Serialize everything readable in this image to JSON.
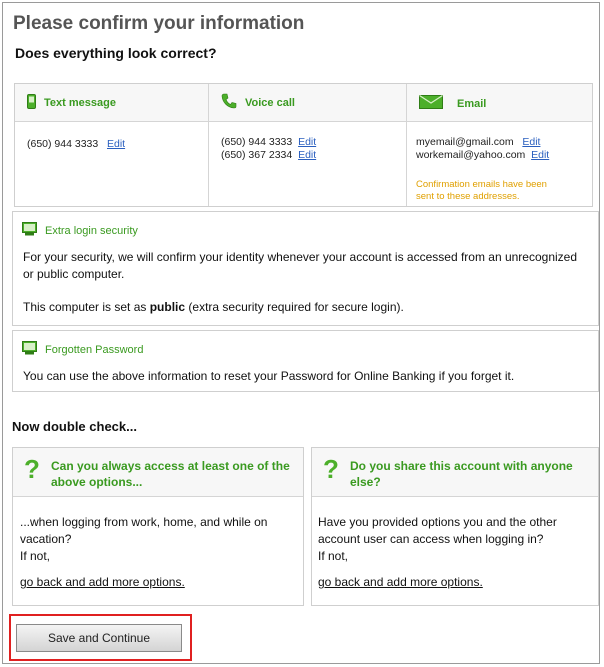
{
  "title": "Please confirm your information",
  "subtitle": "Does everything look correct?",
  "contact": {
    "text": {
      "header": "Text message",
      "phone": "(650) 944 3333",
      "edit": "Edit",
      "icon": "phone-icon"
    },
    "voice": {
      "header": "Voice call",
      "phones": [
        "(650) 944 3333",
        "(650) 367 2334"
      ],
      "edit": "Edit",
      "icon": "handset-icon"
    },
    "email": {
      "header": "Email",
      "addresses": [
        "myemail@gmail.com",
        "workemail@yahoo.com"
      ],
      "edit": "Edit",
      "note": "Confirmation emails have been sent to these addresses.",
      "icon": "envelope-icon"
    }
  },
  "security": {
    "header": "Extra login security",
    "text1": "For your security, we will confirm your identity whenever your account is accessed from an unrecognized or public computer.",
    "text2_prefix": "This computer is set as ",
    "text2_bold": "public",
    "text2_suffix": " (extra security required for secure login).",
    "icon": "computer-icon"
  },
  "forgotten": {
    "header": "Forgotten Password",
    "text": "You can use the above information to reset your Password for Online Banking if you forget it.",
    "icon": "computer-icon"
  },
  "double_check": {
    "title": "Now double check...",
    "left": {
      "question": "Can you always access at least one of the above options...",
      "body": "...when logging from work, home, and while on vacation?",
      "ifnot": "If not,",
      "link": "go back and add more options."
    },
    "right": {
      "question": "Do you share this account with anyone else?",
      "body": "Have you provided options you and the other account user can access when logging in?",
      "ifnot": "If not,",
      "link": "go back and add more options."
    }
  },
  "save_button": "Save and Continue",
  "colors": {
    "accent_green": "#3a9a20",
    "link_blue": "#2a5fbf",
    "note_yellow": "#e0a000",
    "highlight_red": "#e02020"
  }
}
